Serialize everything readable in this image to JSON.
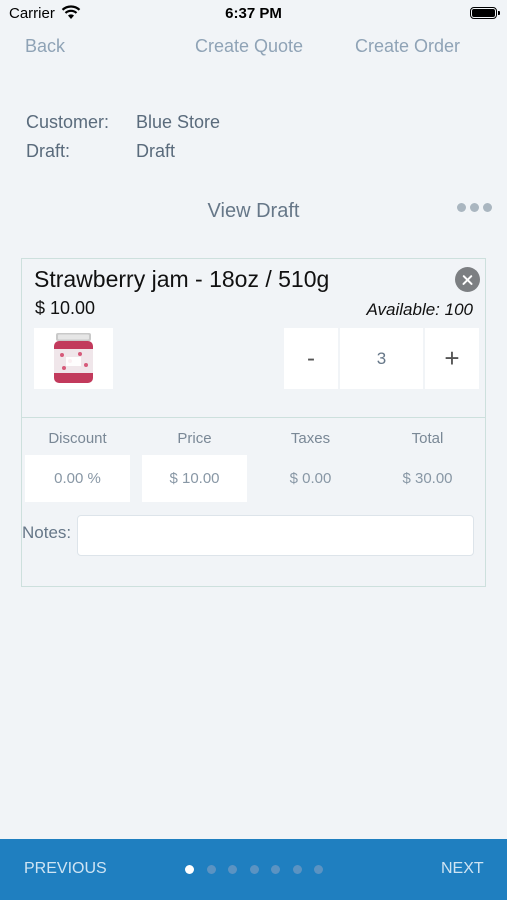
{
  "status_bar": {
    "carrier": "Carrier",
    "time": "6:37 PM"
  },
  "nav": {
    "back": "Back",
    "create_quote": "Create Quote",
    "create_order": "Create Order"
  },
  "info": {
    "customer_label": "Customer:",
    "customer_value": "Blue Store",
    "draft_label": "Draft:",
    "draft_value": "Draft"
  },
  "view_title": "View Draft",
  "item": {
    "title": "Strawberry jam - 18oz / 510g",
    "price": "$ 10.00",
    "available": "Available: 100",
    "quantity": "3",
    "minus": "-",
    "plus": "+"
  },
  "columns": {
    "discount": "Discount",
    "price": "Price",
    "taxes": "Taxes",
    "total": "Total"
  },
  "values": {
    "discount": "0.00 %",
    "price": "$ 10.00",
    "taxes": "$ 0.00",
    "total": "$ 30.00"
  },
  "notes": {
    "label": "Notes:",
    "value": ""
  },
  "bottom": {
    "previous": "PREVIOUS",
    "next": "NEXT",
    "page_count": 7,
    "current_page": 1
  },
  "colors": {
    "accent": "#1f7fc0",
    "background": "#f1f4f7"
  }
}
